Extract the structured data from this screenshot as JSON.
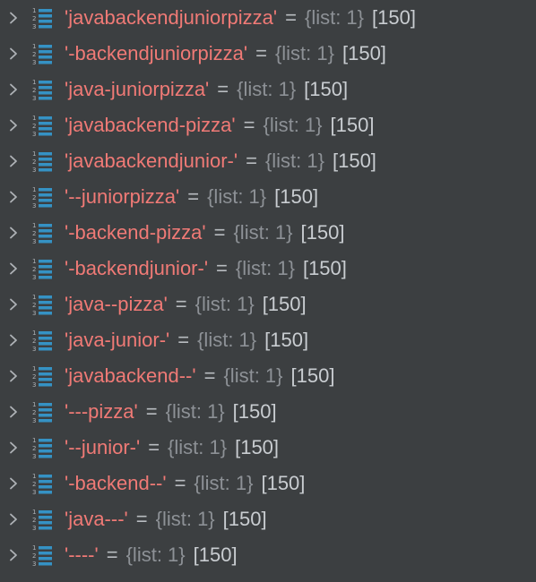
{
  "variables": {
    "items": [
      {
        "key": "'javabackendjuniorpizza'",
        "eq": "=",
        "type_info": "{list: 1}",
        "value": "[150]"
      },
      {
        "key": "'-backendjuniorpizza'",
        "eq": "=",
        "type_info": "{list: 1}",
        "value": "[150]"
      },
      {
        "key": "'java-juniorpizza'",
        "eq": "=",
        "type_info": "{list: 1}",
        "value": "[150]"
      },
      {
        "key": "'javabackend-pizza'",
        "eq": "=",
        "type_info": "{list: 1}",
        "value": "[150]"
      },
      {
        "key": "'javabackendjunior-'",
        "eq": "=",
        "type_info": "{list: 1}",
        "value": "[150]"
      },
      {
        "key": "'--juniorpizza'",
        "eq": "=",
        "type_info": "{list: 1}",
        "value": "[150]"
      },
      {
        "key": "'-backend-pizza'",
        "eq": "=",
        "type_info": "{list: 1}",
        "value": "[150]"
      },
      {
        "key": "'-backendjunior-'",
        "eq": "=",
        "type_info": "{list: 1}",
        "value": "[150]"
      },
      {
        "key": "'java--pizza'",
        "eq": "=",
        "type_info": "{list: 1}",
        "value": "[150]"
      },
      {
        "key": "'java-junior-'",
        "eq": "=",
        "type_info": "{list: 1}",
        "value": "[150]"
      },
      {
        "key": "'javabackend--'",
        "eq": "=",
        "type_info": "{list: 1}",
        "value": "[150]"
      },
      {
        "key": "'---pizza'",
        "eq": "=",
        "type_info": "{list: 1}",
        "value": "[150]"
      },
      {
        "key": "'--junior-'",
        "eq": "=",
        "type_info": "{list: 1}",
        "value": "[150]"
      },
      {
        "key": "'-backend--'",
        "eq": "=",
        "type_info": "{list: 1}",
        "value": "[150]"
      },
      {
        "key": "'java---'",
        "eq": "=",
        "type_info": "{list: 1}",
        "value": "[150]"
      },
      {
        "key": "'----'",
        "eq": "=",
        "type_info": "{list: 1}",
        "value": "[150]"
      }
    ],
    "icons": {
      "expand": "chevron-right-icon",
      "list": "list-icon"
    },
    "colors": {
      "background": "#3c3f41",
      "key": "#f07a76",
      "type_info": "#8d9196",
      "value": "#c9cdd1",
      "icon_accent": "#3592c4"
    }
  }
}
